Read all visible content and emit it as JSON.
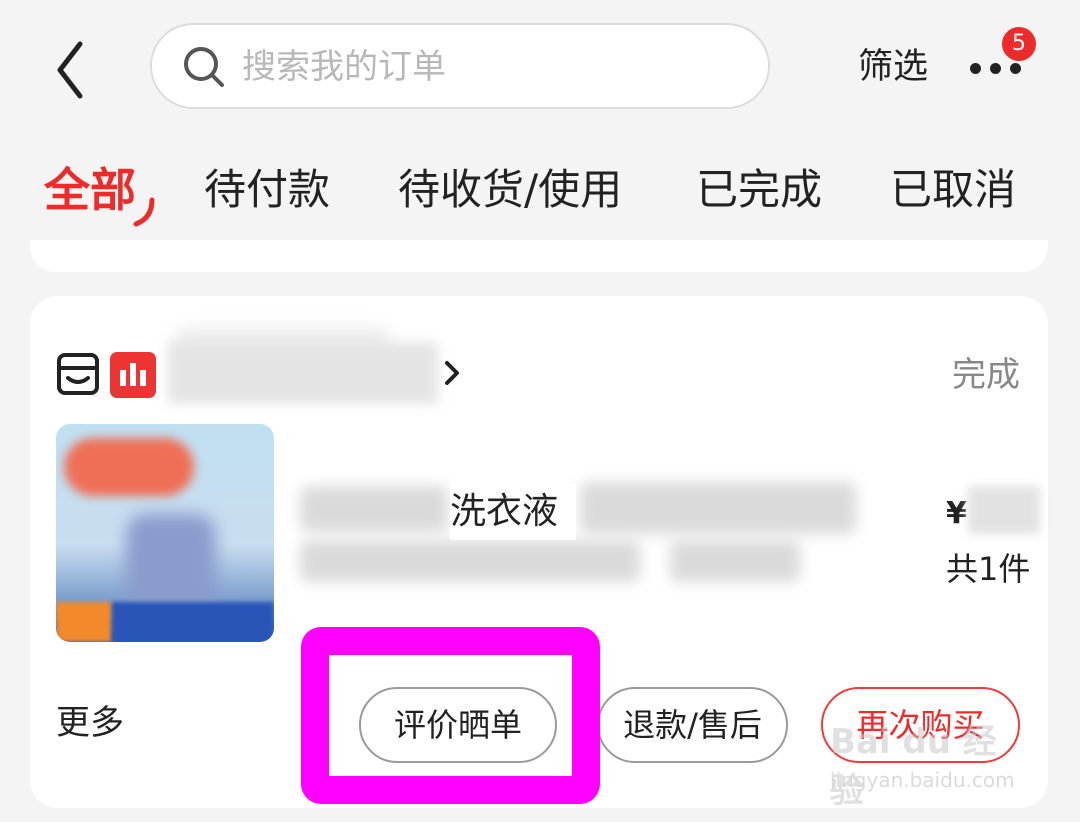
{
  "header": {
    "search_placeholder": "搜索我的订单",
    "filter_label": "筛选",
    "more_badge_count": "5"
  },
  "tabs": [
    {
      "label": "全部",
      "active": true
    },
    {
      "label": "待付款",
      "active": false
    },
    {
      "label": "待收货/使用",
      "active": false
    },
    {
      "label": "已完成",
      "active": false
    },
    {
      "label": "已取消",
      "active": false
    }
  ],
  "order": {
    "status": "完成",
    "product_title_keyword": "洗衣液",
    "price_currency": "¥",
    "quantity_text": "共1件",
    "more_label": "更多",
    "actions": {
      "review": "评价晒单",
      "refund": "退款/售后",
      "rebuy": "再次购买"
    }
  },
  "watermark": {
    "logo_text": "Bai du 经验",
    "url": "jingyan.baidu.com"
  },
  "colors": {
    "accent_red": "#ee2b2b",
    "highlight_magenta": "#ff00ff",
    "background": "#f4f4f4",
    "card": "#ffffff"
  },
  "icons": [
    "back-arrow-icon",
    "search-icon",
    "more-dots-icon",
    "shop-icon",
    "shop-logo-icon",
    "chevron-right-icon"
  ]
}
